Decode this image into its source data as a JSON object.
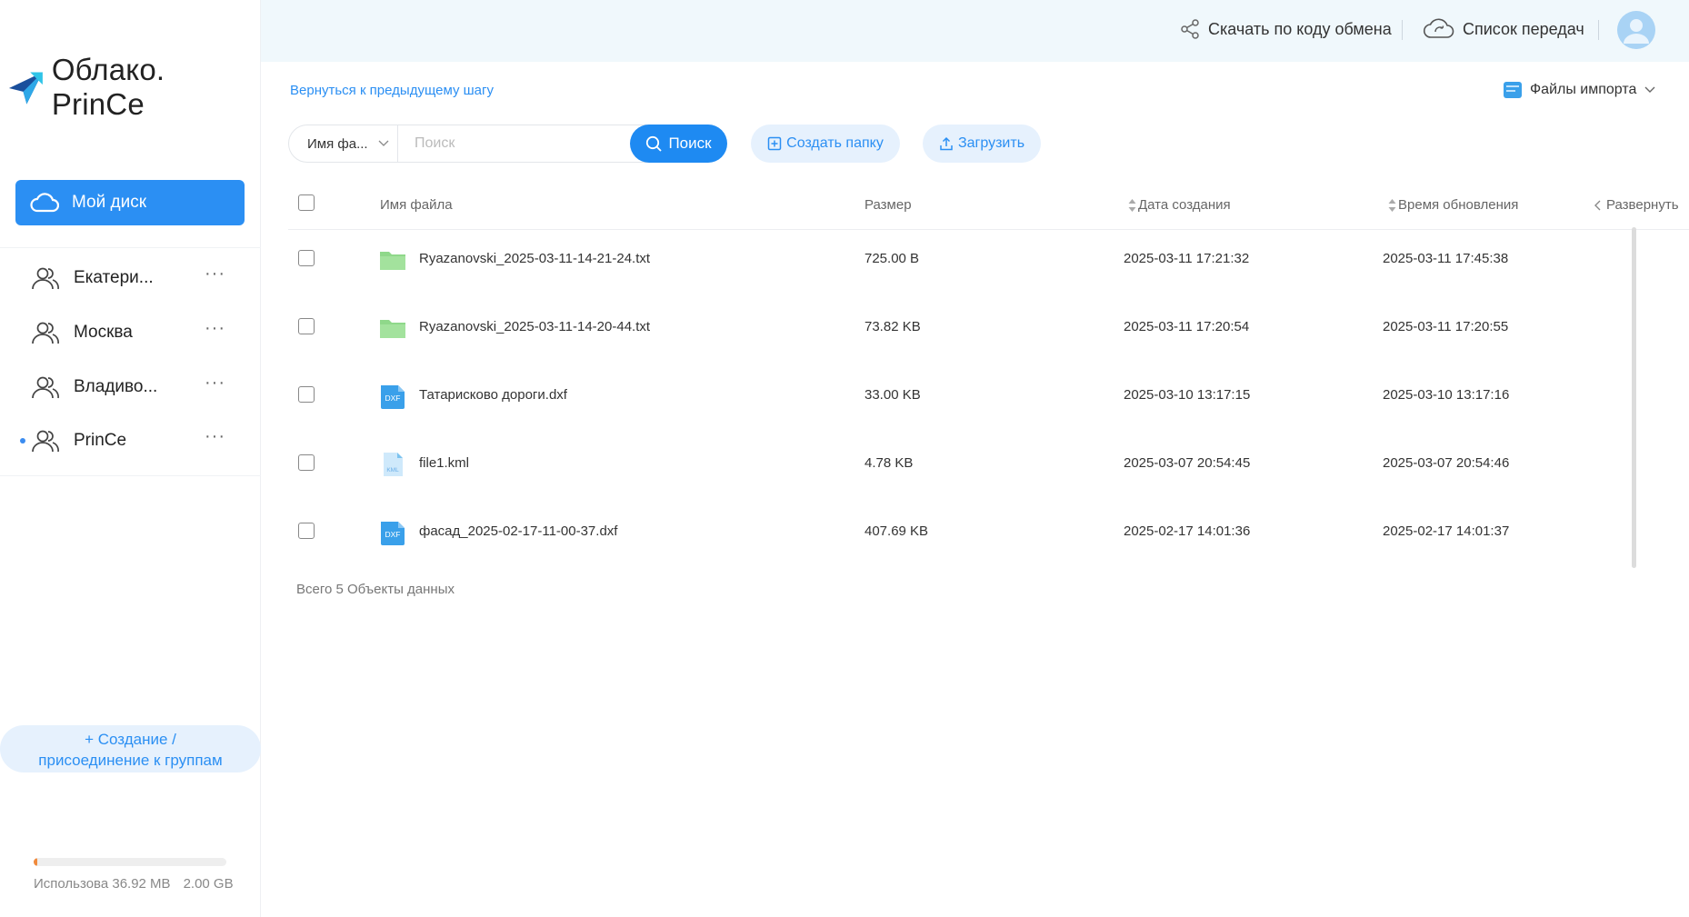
{
  "app": {
    "logo_text": "Облако. PrinCe"
  },
  "sidebar": {
    "my_disk_label": "Мой диск",
    "groups": [
      {
        "name": "Екатери...",
        "more": "···",
        "active": false
      },
      {
        "name": "Москва",
        "more": "···",
        "active": false
      },
      {
        "name": "Владиво...",
        "more": "···",
        "active": false
      },
      {
        "name": "PrinCe",
        "more": "···",
        "active": true
      }
    ],
    "create_group_line1": "+ Создание /",
    "create_group_line2": "присоединение к группам",
    "storage": {
      "used_label": "Использова 36.92 MB",
      "total_label": "2.00 GB",
      "used_fraction": 0.018
    }
  },
  "header": {
    "download_by_code": "Скачать по коду обмена",
    "transfer_list": "Список передач"
  },
  "main": {
    "back_link": "Вернуться к предыдущему шагу",
    "import_files": "Файлы импорта",
    "search": {
      "field_select": "Имя фа...",
      "placeholder": "Поиск",
      "button": "Поиск"
    },
    "create_folder": "Создать папку",
    "upload": "Загрузить",
    "columns": {
      "name": "Имя файла",
      "size": "Размер",
      "created": "Дата создания",
      "updated": "Время обновления",
      "expand": "Развернуть"
    },
    "files": [
      {
        "name": "Ryazanovski_2025-03-11-14-21-24.txt",
        "type": "folder",
        "size": "725.00 B",
        "created": "2025-03-11 17:21:32",
        "updated": "2025-03-11 17:45:38"
      },
      {
        "name": "Ryazanovski_2025-03-11-14-20-44.txt",
        "type": "folder",
        "size": "73.82 KB",
        "created": "2025-03-11 17:20:54",
        "updated": "2025-03-11 17:20:55"
      },
      {
        "name": "Татарисково дороги.dxf",
        "type": "dxf",
        "size": "33.00 KB",
        "created": "2025-03-10 13:17:15",
        "updated": "2025-03-10 13:17:16"
      },
      {
        "name": "file1.kml",
        "type": "kml",
        "size": "4.78 KB",
        "created": "2025-03-07 20:54:45",
        "updated": "2025-03-07 20:54:46"
      },
      {
        "name": "фасад_2025-02-17-11-00-37.dxf",
        "type": "dxf",
        "size": "407.69 KB",
        "created": "2025-02-17 14:01:36",
        "updated": "2025-02-17 14:01:37"
      }
    ],
    "icon_labels": {
      "dxf": "DXF",
      "kml": "KML"
    },
    "total": "Всего 5 Объекты данных"
  },
  "colors": {
    "accent": "#2b8ff3",
    "folder": "#8fd88a",
    "dxf": "#3aa0ea",
    "kml": "#7cc3ef"
  }
}
